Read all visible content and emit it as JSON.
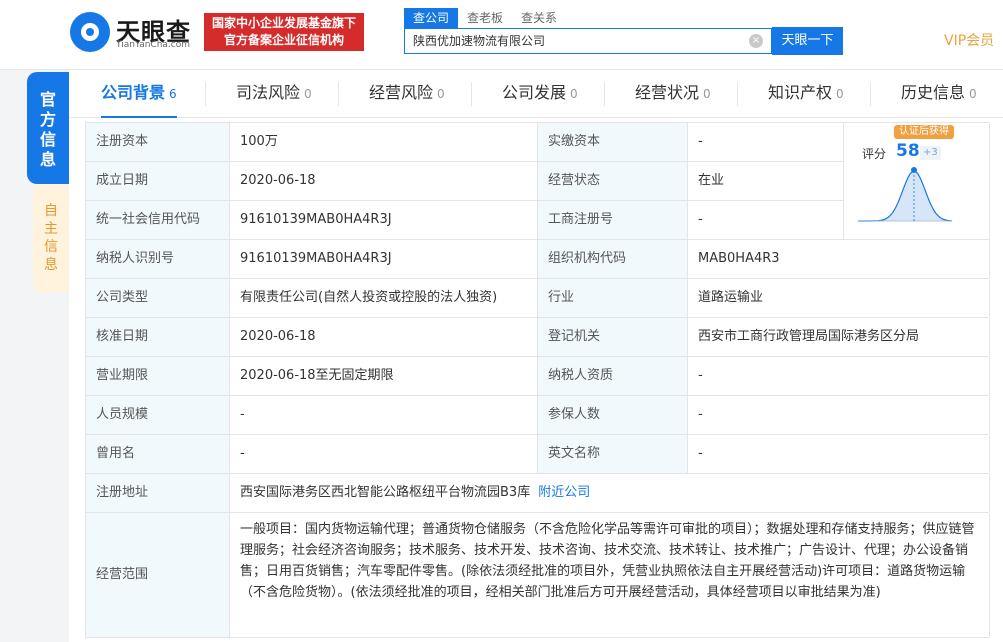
{
  "header": {
    "logo_text": "天眼查",
    "logo_domain": "TianYanCha.com",
    "badge_line1": "国家中小企业发展基金旗下",
    "badge_line2": "官方备案企业征信机构",
    "search_tabs": [
      "查公司",
      "查老板",
      "查关系"
    ],
    "search_value": "陕西优加速物流有限公司",
    "search_button": "天眼一下",
    "vip": "VIP会员",
    "clear_icon": "×"
  },
  "side_tabs": {
    "official": "官方信息",
    "self": "自主信息"
  },
  "tabs": [
    {
      "label": "公司背景",
      "count": "6"
    },
    {
      "label": "司法风险",
      "count": "0"
    },
    {
      "label": "经营风险",
      "count": "0"
    },
    {
      "label": "公司发展",
      "count": "0"
    },
    {
      "label": "经营状况",
      "count": "0"
    },
    {
      "label": "知识产权",
      "count": "0"
    },
    {
      "label": "历史信息",
      "count": "0"
    }
  ],
  "score": {
    "tag": "认证后获得",
    "label": "评分",
    "value": "58",
    "increment": "+3"
  },
  "rows": [
    {
      "l1": "注册资本",
      "v1": "100万",
      "l2": "实缴资本",
      "v2": "-"
    },
    {
      "l1": "成立日期",
      "v1": "2020-06-18",
      "l2": "经营状态",
      "v2": "在业"
    },
    {
      "l1": "统一社会信用代码",
      "v1": "91610139MAB0HA4R3J",
      "l2": "工商注册号",
      "v2": "-"
    },
    {
      "l1": "纳税人识别号",
      "v1": "91610139MAB0HA4R3J",
      "l2": "组织机构代码",
      "v2": "MAB0HA4R3"
    },
    {
      "l1": "公司类型",
      "v1": "有限责任公司(自然人投资或控股的法人独资)",
      "l2": "行业",
      "v2": "道路运输业"
    },
    {
      "l1": "核准日期",
      "v1": "2020-06-18",
      "l2": "登记机关",
      "v2": "西安市工商行政管理局国际港务区分局"
    },
    {
      "l1": "营业期限",
      "v1": "2020-06-18至无固定期限",
      "l2": "纳税人资质",
      "v2": "-"
    },
    {
      "l1": "人员规模",
      "v1": "-",
      "l2": "参保人数",
      "v2": "-"
    },
    {
      "l1": "曾用名",
      "v1": "-",
      "l2": "英文名称",
      "v2": "-"
    }
  ],
  "address": {
    "label": "注册地址",
    "value": "西安国际港务区西北智能公路枢纽平台物流园B3库",
    "link": "附近公司"
  },
  "scope": {
    "label": "经营范围",
    "value": "一般项目：国内货物运输代理；普通货物仓储服务（不含危险化学品等需许可审批的项目）；数据处理和存储支持服务；供应链管理服务；社会经济咨询服务；技术服务、技术开发、技术咨询、技术交流、技术转让、技术推广；广告设计、代理；办公设备销售；日用百货销售；汽车零配件零售。(除依法须经批准的项目外，凭营业执照依法自主开展经营活动)许可项目：道路货物运输（不含危险货物）。(依法须经批准的项目，经相关部门批准后方可开展经营活动，具体经营项目以审批结果为准)"
  }
}
